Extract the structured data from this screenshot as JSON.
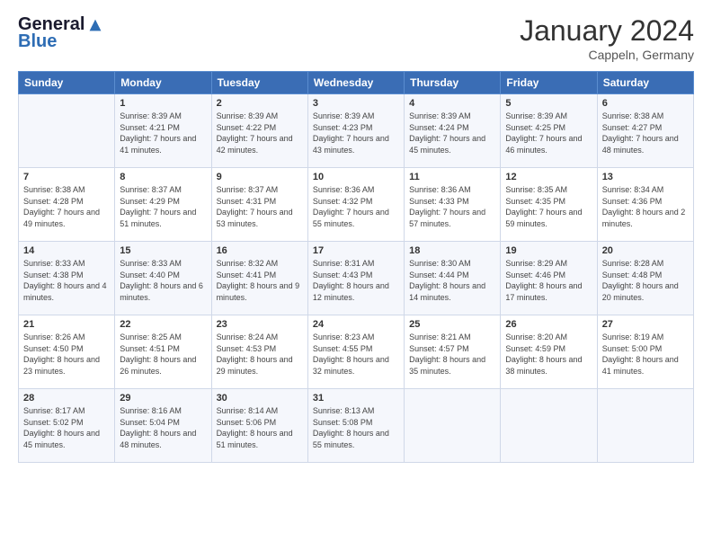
{
  "header": {
    "logo_general": "General",
    "logo_blue": "Blue",
    "title": "January 2024",
    "location": "Cappeln, Germany"
  },
  "days_of_week": [
    "Sunday",
    "Monday",
    "Tuesday",
    "Wednesday",
    "Thursday",
    "Friday",
    "Saturday"
  ],
  "weeks": [
    [
      {
        "day": "",
        "sunrise": "",
        "sunset": "",
        "daylight": ""
      },
      {
        "day": "1",
        "sunrise": "Sunrise: 8:39 AM",
        "sunset": "Sunset: 4:21 PM",
        "daylight": "Daylight: 7 hours and 41 minutes."
      },
      {
        "day": "2",
        "sunrise": "Sunrise: 8:39 AM",
        "sunset": "Sunset: 4:22 PM",
        "daylight": "Daylight: 7 hours and 42 minutes."
      },
      {
        "day": "3",
        "sunrise": "Sunrise: 8:39 AM",
        "sunset": "Sunset: 4:23 PM",
        "daylight": "Daylight: 7 hours and 43 minutes."
      },
      {
        "day": "4",
        "sunrise": "Sunrise: 8:39 AM",
        "sunset": "Sunset: 4:24 PM",
        "daylight": "Daylight: 7 hours and 45 minutes."
      },
      {
        "day": "5",
        "sunrise": "Sunrise: 8:39 AM",
        "sunset": "Sunset: 4:25 PM",
        "daylight": "Daylight: 7 hours and 46 minutes."
      },
      {
        "day": "6",
        "sunrise": "Sunrise: 8:38 AM",
        "sunset": "Sunset: 4:27 PM",
        "daylight": "Daylight: 7 hours and 48 minutes."
      }
    ],
    [
      {
        "day": "7",
        "sunrise": "Sunrise: 8:38 AM",
        "sunset": "Sunset: 4:28 PM",
        "daylight": "Daylight: 7 hours and 49 minutes."
      },
      {
        "day": "8",
        "sunrise": "Sunrise: 8:37 AM",
        "sunset": "Sunset: 4:29 PM",
        "daylight": "Daylight: 7 hours and 51 minutes."
      },
      {
        "day": "9",
        "sunrise": "Sunrise: 8:37 AM",
        "sunset": "Sunset: 4:31 PM",
        "daylight": "Daylight: 7 hours and 53 minutes."
      },
      {
        "day": "10",
        "sunrise": "Sunrise: 8:36 AM",
        "sunset": "Sunset: 4:32 PM",
        "daylight": "Daylight: 7 hours and 55 minutes."
      },
      {
        "day": "11",
        "sunrise": "Sunrise: 8:36 AM",
        "sunset": "Sunset: 4:33 PM",
        "daylight": "Daylight: 7 hours and 57 minutes."
      },
      {
        "day": "12",
        "sunrise": "Sunrise: 8:35 AM",
        "sunset": "Sunset: 4:35 PM",
        "daylight": "Daylight: 7 hours and 59 minutes."
      },
      {
        "day": "13",
        "sunrise": "Sunrise: 8:34 AM",
        "sunset": "Sunset: 4:36 PM",
        "daylight": "Daylight: 8 hours and 2 minutes."
      }
    ],
    [
      {
        "day": "14",
        "sunrise": "Sunrise: 8:33 AM",
        "sunset": "Sunset: 4:38 PM",
        "daylight": "Daylight: 8 hours and 4 minutes."
      },
      {
        "day": "15",
        "sunrise": "Sunrise: 8:33 AM",
        "sunset": "Sunset: 4:40 PM",
        "daylight": "Daylight: 8 hours and 6 minutes."
      },
      {
        "day": "16",
        "sunrise": "Sunrise: 8:32 AM",
        "sunset": "Sunset: 4:41 PM",
        "daylight": "Daylight: 8 hours and 9 minutes."
      },
      {
        "day": "17",
        "sunrise": "Sunrise: 8:31 AM",
        "sunset": "Sunset: 4:43 PM",
        "daylight": "Daylight: 8 hours and 12 minutes."
      },
      {
        "day": "18",
        "sunrise": "Sunrise: 8:30 AM",
        "sunset": "Sunset: 4:44 PM",
        "daylight": "Daylight: 8 hours and 14 minutes."
      },
      {
        "day": "19",
        "sunrise": "Sunrise: 8:29 AM",
        "sunset": "Sunset: 4:46 PM",
        "daylight": "Daylight: 8 hours and 17 minutes."
      },
      {
        "day": "20",
        "sunrise": "Sunrise: 8:28 AM",
        "sunset": "Sunset: 4:48 PM",
        "daylight": "Daylight: 8 hours and 20 minutes."
      }
    ],
    [
      {
        "day": "21",
        "sunrise": "Sunrise: 8:26 AM",
        "sunset": "Sunset: 4:50 PM",
        "daylight": "Daylight: 8 hours and 23 minutes."
      },
      {
        "day": "22",
        "sunrise": "Sunrise: 8:25 AM",
        "sunset": "Sunset: 4:51 PM",
        "daylight": "Daylight: 8 hours and 26 minutes."
      },
      {
        "day": "23",
        "sunrise": "Sunrise: 8:24 AM",
        "sunset": "Sunset: 4:53 PM",
        "daylight": "Daylight: 8 hours and 29 minutes."
      },
      {
        "day": "24",
        "sunrise": "Sunrise: 8:23 AM",
        "sunset": "Sunset: 4:55 PM",
        "daylight": "Daylight: 8 hours and 32 minutes."
      },
      {
        "day": "25",
        "sunrise": "Sunrise: 8:21 AM",
        "sunset": "Sunset: 4:57 PM",
        "daylight": "Daylight: 8 hours and 35 minutes."
      },
      {
        "day": "26",
        "sunrise": "Sunrise: 8:20 AM",
        "sunset": "Sunset: 4:59 PM",
        "daylight": "Daylight: 8 hours and 38 minutes."
      },
      {
        "day": "27",
        "sunrise": "Sunrise: 8:19 AM",
        "sunset": "Sunset: 5:00 PM",
        "daylight": "Daylight: 8 hours and 41 minutes."
      }
    ],
    [
      {
        "day": "28",
        "sunrise": "Sunrise: 8:17 AM",
        "sunset": "Sunset: 5:02 PM",
        "daylight": "Daylight: 8 hours and 45 minutes."
      },
      {
        "day": "29",
        "sunrise": "Sunrise: 8:16 AM",
        "sunset": "Sunset: 5:04 PM",
        "daylight": "Daylight: 8 hours and 48 minutes."
      },
      {
        "day": "30",
        "sunrise": "Sunrise: 8:14 AM",
        "sunset": "Sunset: 5:06 PM",
        "daylight": "Daylight: 8 hours and 51 minutes."
      },
      {
        "day": "31",
        "sunrise": "Sunrise: 8:13 AM",
        "sunset": "Sunset: 5:08 PM",
        "daylight": "Daylight: 8 hours and 55 minutes."
      },
      {
        "day": "",
        "sunrise": "",
        "sunset": "",
        "daylight": ""
      },
      {
        "day": "",
        "sunrise": "",
        "sunset": "",
        "daylight": ""
      },
      {
        "day": "",
        "sunrise": "",
        "sunset": "",
        "daylight": ""
      }
    ]
  ]
}
